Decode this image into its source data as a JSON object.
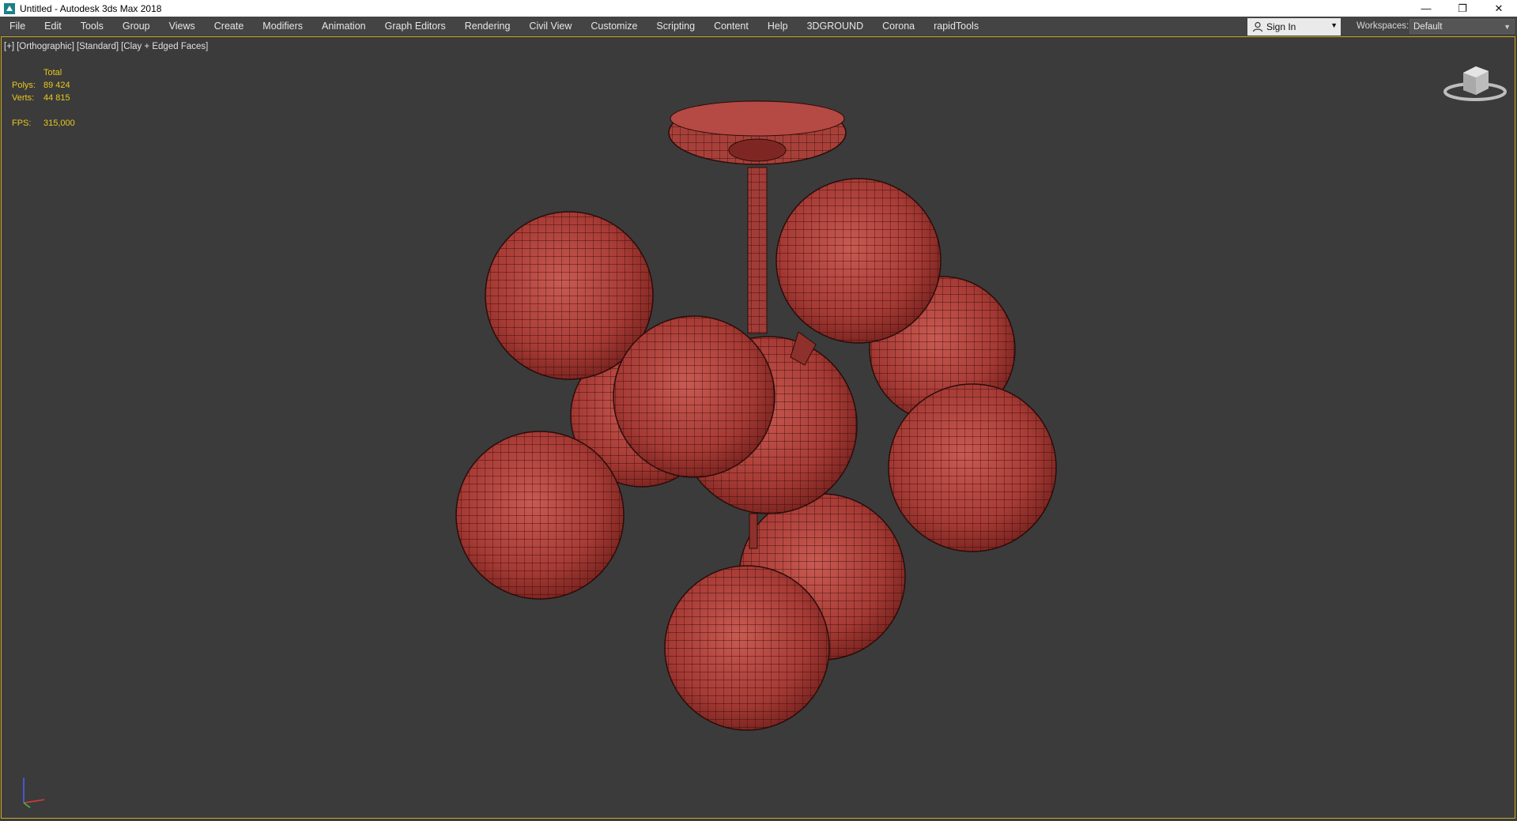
{
  "window": {
    "title": "Untitled - Autodesk 3ds Max 2018",
    "controls": {
      "minimize": "—",
      "restore": "❐",
      "close": "✕"
    }
  },
  "menu": {
    "items": [
      "File",
      "Edit",
      "Tools",
      "Group",
      "Views",
      "Create",
      "Modifiers",
      "Animation",
      "Graph Editors",
      "Rendering",
      "Civil View",
      "Customize",
      "Scripting",
      "Content",
      "Help",
      "3DGROUND",
      "Corona",
      "rapidTools"
    ]
  },
  "account": {
    "sign_in": "Sign In"
  },
  "workspaces": {
    "label": "Workspaces:",
    "value": "Default"
  },
  "viewport": {
    "labels": [
      "[+]",
      "[Orthographic]",
      "[Standard]",
      "[Clay + Edged Faces]"
    ],
    "stats": {
      "header": "Total",
      "polys_label": "Polys:",
      "polys_value": "89 424",
      "verts_label": "Verts:",
      "verts_value": "44 815",
      "fps_label": "FPS:",
      "fps_value": "315,000"
    }
  },
  "colors": {
    "model": "#b0403a",
    "viewport_bg": "#3b3b3b",
    "stats_text": "#e8c81e",
    "active_border": "#ccaa22"
  }
}
